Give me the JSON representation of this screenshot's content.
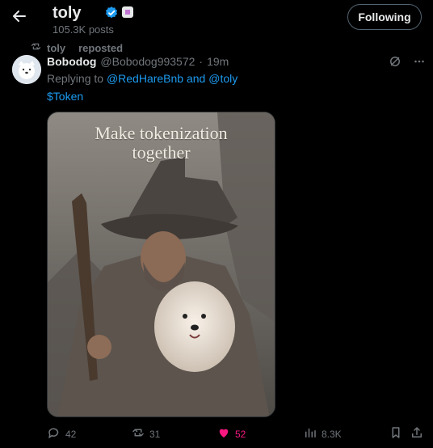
{
  "header": {
    "title": "toly",
    "posts": "105.3K posts",
    "follow_label": "Following"
  },
  "tweet": {
    "repost_by": "toly",
    "repost_label": "reposted",
    "author_name": "Bobodog",
    "author_handle": "@Bobodog993572",
    "separator": "·",
    "time": "19m",
    "reply_prefix": "Replying to",
    "reply_user1": "@RedHareBnb",
    "reply_and": "and",
    "reply_user2": "@toly",
    "text": "$Token",
    "image_text_line1": "Make tokenization",
    "image_text_line2": "together",
    "stats": {
      "replies": "42",
      "reposts": "31",
      "likes": "52",
      "views": "8.3K"
    }
  },
  "colors": {
    "accent": "#1d9bf0",
    "like": "#f91880",
    "text": "#e7e9ea",
    "muted": "#71767b",
    "background": "#000000"
  },
  "icons": {
    "back": "arrow-left-icon",
    "verified": "verified-badge-icon",
    "affiliate": "affiliate-badge-icon",
    "repost": "repost-icon",
    "grok": "grok-icon",
    "more": "more-icon",
    "reply": "reply-icon",
    "like": "heart-icon",
    "views": "views-icon",
    "bookmark": "bookmark-icon",
    "share": "share-icon"
  }
}
